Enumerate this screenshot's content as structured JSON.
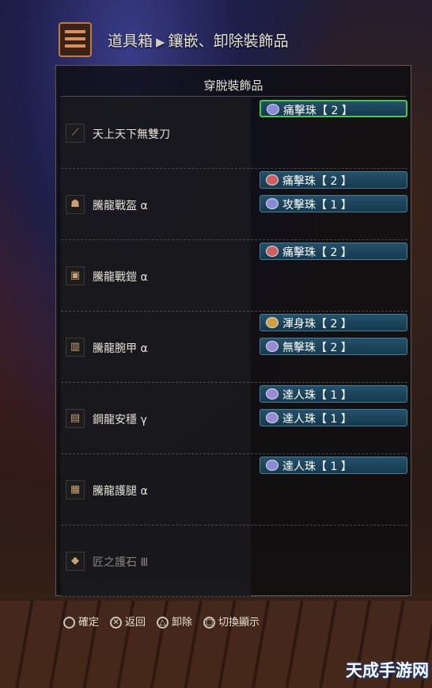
{
  "header": {
    "crumb_1": "道具箱",
    "crumb_2": "鑲嵌、卸除裝飾品",
    "icon": "item-box-icon"
  },
  "panel": {
    "title": "穿脫裝飾品",
    "rows": [
      {
        "equip": "天上天下無雙刀",
        "icon": "long-sword-icon",
        "decorations": [
          {
            "label": "痛擊珠【 2 】",
            "selected": true
          }
        ]
      },
      {
        "equip": "騰龍戰盔 α",
        "icon": "helm-icon",
        "decorations": [
          {
            "label": "痛擊珠【 2 】"
          },
          {
            "label": "攻擊珠【 1 】"
          }
        ]
      },
      {
        "equip": "騰龍戰鎧 α",
        "icon": "chest-armor-icon",
        "decorations": [
          {
            "label": "痛擊珠【 2 】"
          }
        ]
      },
      {
        "equip": "騰龍腕甲 α",
        "icon": "gauntlet-icon",
        "decorations": [
          {
            "label": "渾身珠【 2 】"
          },
          {
            "label": "無擊珠【 2 】"
          }
        ]
      },
      {
        "equip": "鋼龍安穩 γ",
        "icon": "waist-armor-icon",
        "decorations": [
          {
            "label": "達人珠【 1 】"
          },
          {
            "label": "達人珠【 1 】"
          }
        ]
      },
      {
        "equip": "騰龍護腿 α",
        "icon": "leg-armor-icon",
        "decorations": [
          {
            "label": "達人珠【 1 】"
          }
        ]
      },
      {
        "equip": "匠之護石 Ⅲ",
        "icon": "charm-icon",
        "dim": true,
        "decorations": []
      }
    ]
  },
  "controls": [
    {
      "name": "confirm",
      "label": "確定",
      "icon": "circle-button-icon"
    },
    {
      "name": "back",
      "label": "返回",
      "icon": "cross-button-icon"
    },
    {
      "name": "remove",
      "label": "卸除",
      "icon": "triangle-button-icon"
    },
    {
      "name": "toggle",
      "label": "切換顯示",
      "icon": "square-button-icon"
    }
  ],
  "watermark": "天成手游网",
  "colors": {
    "deco_bg": "#163a4e",
    "selected_border": "#4ec94e",
    "header_icon": "#c07a46"
  }
}
